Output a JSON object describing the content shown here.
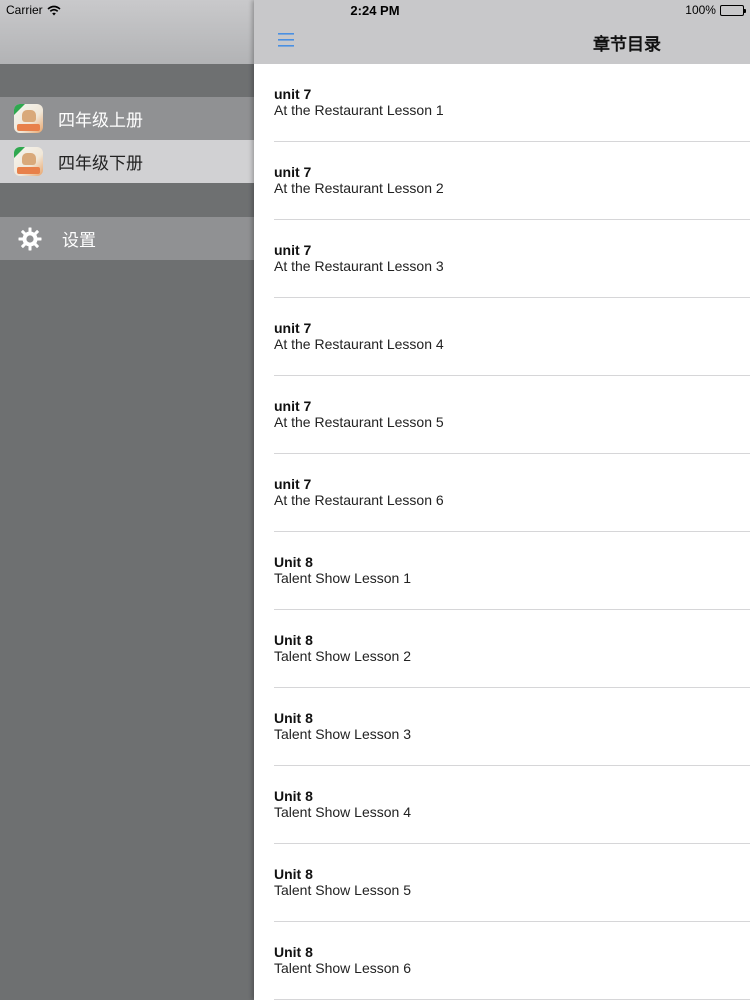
{
  "status_bar": {
    "carrier": "Carrier",
    "time": "2:24 PM",
    "battery": "100%"
  },
  "sidebar": {
    "items": [
      {
        "label": "四年级上册",
        "icon": "book-cover-icon"
      },
      {
        "label": "四年级下册",
        "icon": "book-cover-icon",
        "selected": true
      },
      {
        "label": "设置",
        "icon": "gear-icon"
      }
    ]
  },
  "navbar": {
    "title": "章节目录",
    "menu_icon": "hamburger-menu-icon",
    "accent_color": "#4a90e2"
  },
  "chapters": [
    {
      "unit": "unit 7",
      "lesson": "At the Restaurant Lesson 1"
    },
    {
      "unit": "unit 7",
      "lesson": "At the Restaurant Lesson 2"
    },
    {
      "unit": "unit 7",
      "lesson": "At the Restaurant Lesson 3"
    },
    {
      "unit": "unit 7",
      "lesson": "At the Restaurant Lesson 4"
    },
    {
      "unit": "unit 7",
      "lesson": "At the Restaurant Lesson 5"
    },
    {
      "unit": "unit 7",
      "lesson": "At the Restaurant Lesson 6"
    },
    {
      "unit": "Unit 8",
      "lesson": "Talent Show Lesson 1"
    },
    {
      "unit": "Unit 8",
      "lesson": "Talent Show Lesson 2"
    },
    {
      "unit": "Unit 8",
      "lesson": "Talent Show Lesson 3"
    },
    {
      "unit": "Unit 8",
      "lesson": "Talent Show Lesson 4"
    },
    {
      "unit": "Unit 8",
      "lesson": "Talent Show Lesson 5"
    },
    {
      "unit": "Unit 8",
      "lesson": "Talent Show Lesson 6"
    }
  ]
}
